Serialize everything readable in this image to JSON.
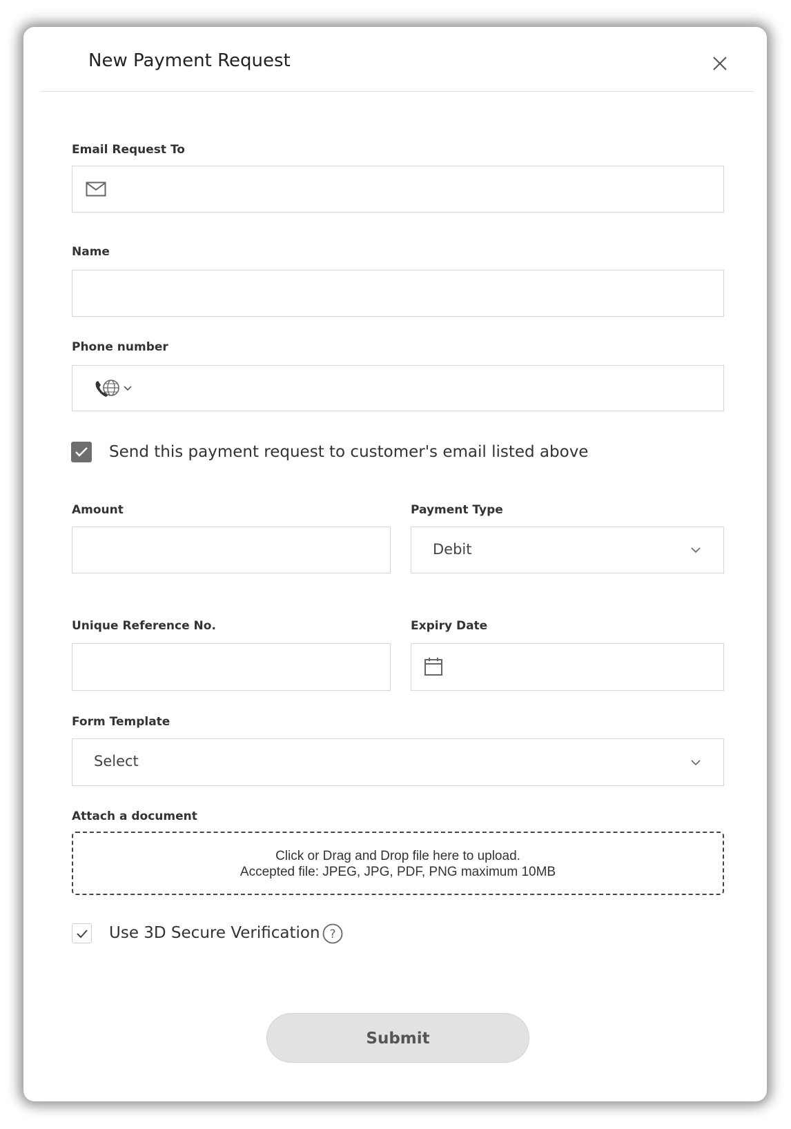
{
  "dialog": {
    "title": "New Payment Request",
    "close_icon": "close-icon"
  },
  "email": {
    "label": "Email Request To",
    "value": "",
    "icon": "envelope-icon"
  },
  "name": {
    "label": "Name",
    "value": ""
  },
  "phone": {
    "label": "Phone number",
    "value": "",
    "icon": "phone-globe-icon"
  },
  "send_email_checkbox": {
    "label": "Send this payment request to customer's email listed above",
    "checked": true
  },
  "amount": {
    "label": "Amount",
    "value": ""
  },
  "payment_type": {
    "label": "Payment Type",
    "selected": "Debit"
  },
  "reference": {
    "label": "Unique Reference No.",
    "value": ""
  },
  "expiry": {
    "label": "Expiry Date",
    "value": "",
    "icon": "calendar-icon"
  },
  "form_template": {
    "label": "Form Template",
    "selected": "Select"
  },
  "attachment": {
    "label": "Attach a document",
    "line1": "Click or Drag and Drop file here to upload.",
    "line2": "Accepted file: JPEG, JPG, PDF, PNG maximum 10MB"
  },
  "secure_checkbox": {
    "label": "Use 3D Secure Verification",
    "checked": true,
    "help_icon": "question-circle-icon"
  },
  "submit": {
    "label": "Submit"
  },
  "colors": {
    "checkbox_fill": "#6e6e6e",
    "submit_bg": "#e2e2e2",
    "border": "#d6d6d6"
  }
}
